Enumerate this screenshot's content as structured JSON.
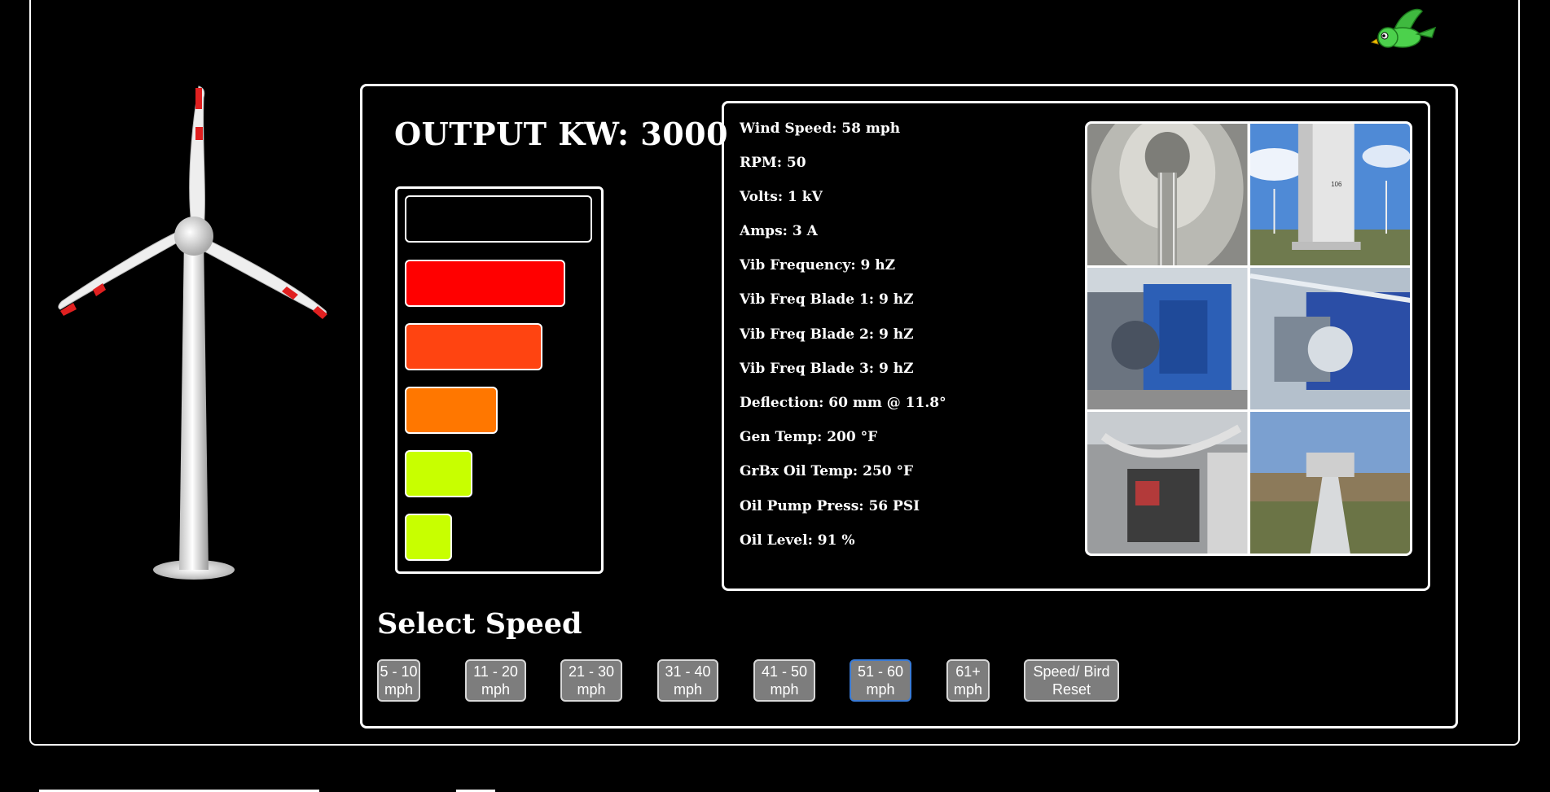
{
  "output": {
    "label": "OUTPUT KW: 3000"
  },
  "meter": {
    "bars": [
      {
        "color": "#000000"
      },
      {
        "color": "#ff0000"
      },
      {
        "color": "#ff4411"
      },
      {
        "color": "#ff7700"
      },
      {
        "color": "#c8ff00"
      },
      {
        "color": "#c8ff00"
      }
    ]
  },
  "readouts": [
    "Wind Speed: 58 mph",
    "RPM: 50",
    "Volts: 1 kV",
    "Amps: 3 A",
    "Vib Frequency: 9 hZ",
    "Vib Freq Blade 1: 9 hZ",
    "Vib Freq Blade 2: 9 hZ",
    "Vib Freq Blade 3: 9 hZ",
    "Deflection: 60 mm @ 11.8°",
    "Gen Temp: 200 °F",
    "GrBx Oil Temp: 250 °F",
    "Oil Pump Press: 56 PSI",
    "Oil Level: 91 %"
  ],
  "photos": {
    "tower_label": "106"
  },
  "speed": {
    "title": "Select Speed",
    "buttons": [
      {
        "line1": "5 - 10",
        "line2": "mph"
      },
      {
        "line1": "11 - 20",
        "line2": "mph"
      },
      {
        "line1": "21 - 30",
        "line2": "mph"
      },
      {
        "line1": "31 - 40",
        "line2": "mph"
      },
      {
        "line1": "41 - 50",
        "line2": "mph"
      },
      {
        "line1": "51 - 60",
        "line2": "mph"
      },
      {
        "line1": "61+",
        "line2": "mph"
      },
      {
        "line1": "Speed/ Bird",
        "line2": "Reset"
      }
    ],
    "active_index": 5
  }
}
